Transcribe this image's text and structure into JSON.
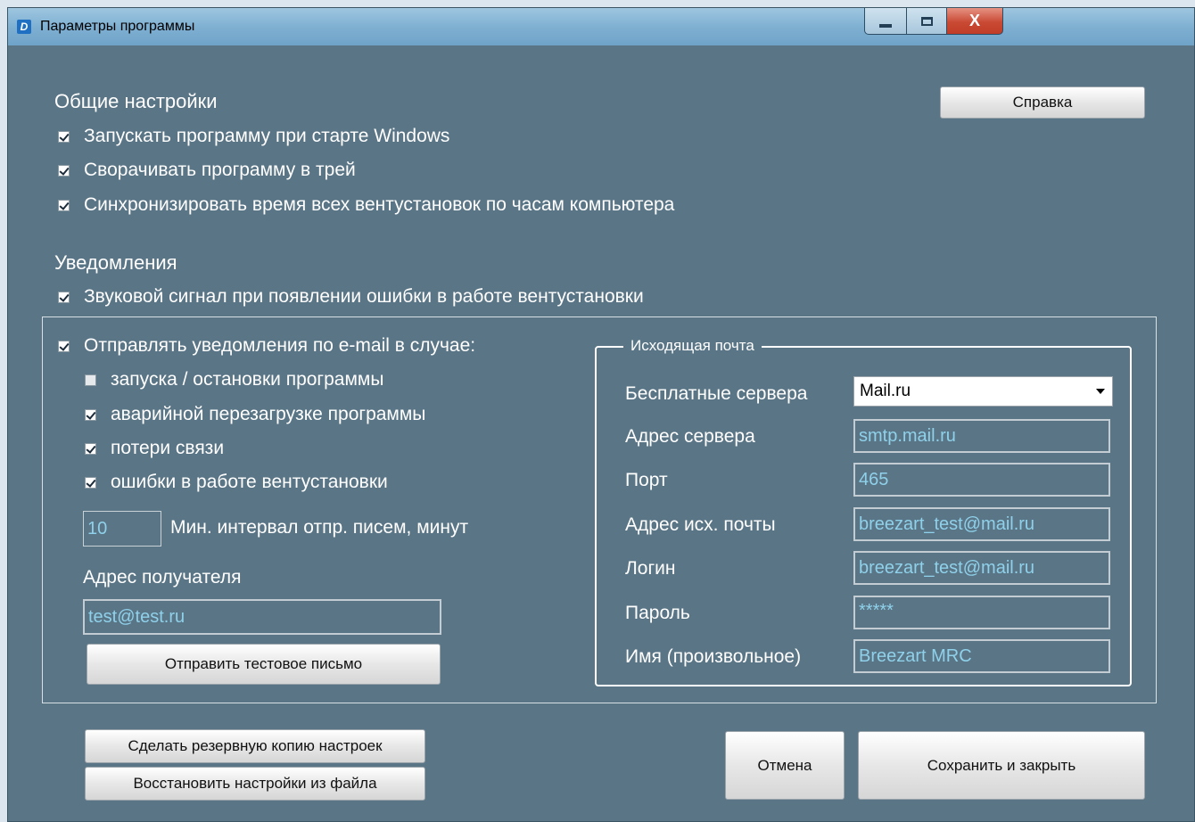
{
  "window": {
    "title": "Параметры программы",
    "close_label": "X"
  },
  "general": {
    "heading": "Общие настройки",
    "help_button": "Справка",
    "options": [
      {
        "label": "Запускать программу при старте Windows",
        "checked": true
      },
      {
        "label": "Сворачивать программу в трей",
        "checked": true
      },
      {
        "label": "Синхронизировать время всех вентустановок по часам компьютера",
        "checked": true
      }
    ]
  },
  "notifications": {
    "heading": "Уведомления",
    "sound": {
      "label": "Звуковой сигнал при появлении ошибки в работе вентустановки",
      "checked": true
    },
    "email": {
      "label": "Отправлять уведомления по e-mail в случае:",
      "checked": true,
      "cases": [
        {
          "label": "запуска / остановки программы",
          "checked": false
        },
        {
          "label": "аварийной перезагрузке программы",
          "checked": true
        },
        {
          "label": "потери связи",
          "checked": true
        },
        {
          "label": "ошибки в работе вентустановки",
          "checked": true
        }
      ],
      "interval_value": "10",
      "interval_label": "Мин. интервал отпр. писем, минут",
      "recipient_label": "Адрес получателя",
      "recipient_value": "test@test.ru",
      "test_button": "Отправить тестовое письмо"
    }
  },
  "outgoing": {
    "legend": "Исходящая почта",
    "free_servers_label": "Бесплатные сервера",
    "free_servers_value": "Mail.ru",
    "server_label": "Адрес сервера",
    "server_value": "smtp.mail.ru",
    "port_label": "Порт",
    "port_value": "465",
    "from_label": "Адрес исх. почты",
    "from_value": "breezart_test@mail.ru",
    "login_label": "Логин",
    "login_value": "breezart_test@mail.ru",
    "password_label": "Пароль",
    "password_value": "*****",
    "name_label": "Имя (произвольное)",
    "name_value": "Breezart MRC"
  },
  "footer": {
    "backup_button": "Сделать резервную копию настроек",
    "restore_button": "Восстановить настройки из файла",
    "cancel_button": "Отмена",
    "save_button": "Сохранить и закрыть"
  }
}
